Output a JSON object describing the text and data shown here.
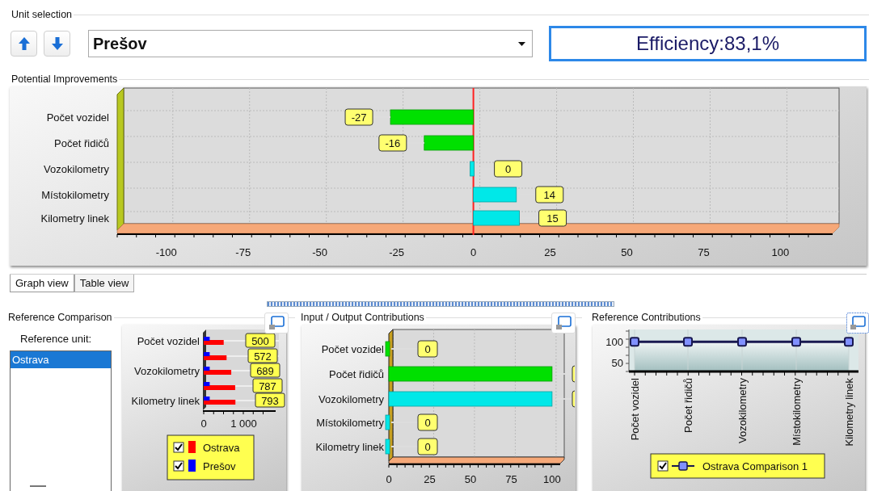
{
  "unit_selection": {
    "title": "Unit selection",
    "unit": "Prešov",
    "efficiency": "Efficiency:83,1%"
  },
  "potential_improvements": {
    "title": "Potential Improvements",
    "chart_data": {
      "type": "bar",
      "orientation": "horizontal",
      "categories": [
        "Počet vozidel",
        "Počet řidičů",
        "Vozokilometry",
        "Místokilometry",
        "Kilometry linek"
      ],
      "series": [
        {
          "color": "#00e000",
          "values": [
            -27,
            -16,
            null,
            null,
            null
          ]
        },
        {
          "color": "#00e8e8",
          "values": [
            null,
            null,
            0,
            14,
            15
          ]
        }
      ],
      "xlim": [
        -116,
        117
      ],
      "xticks": [
        -100,
        -75,
        -50,
        -25,
        0,
        25,
        50,
        75,
        100
      ],
      "grid": true,
      "data_labels": true,
      "ref_lines": [
        {
          "axis": "x",
          "value": 0,
          "color": "#ff2020"
        }
      ]
    },
    "tabs": [
      {
        "label": "Graph view",
        "selected": true
      },
      {
        "label": "Table view",
        "selected": false
      }
    ]
  },
  "reference_comparison": {
    "title": "Reference Comparison",
    "reference_unit_label": "Reference unit:",
    "units": [
      {
        "label": "Ostrava",
        "selected": true
      }
    ],
    "chart_data": {
      "type": "bar",
      "orientation": "horizontal",
      "categories": [
        "Počet vozidel",
        null,
        "Vozokilometry",
        null,
        "Kilometry linek"
      ],
      "series": [
        {
          "name": "Ostrava",
          "color": "#ff0000",
          "values": [
            500,
            572,
            689,
            787,
            793
          ]
        },
        {
          "name": "Prešov",
          "color": "#0000ff",
          "values": [
            150,
            150,
            150,
            150,
            150
          ]
        }
      ],
      "xlim": [
        0,
        1800
      ],
      "xticks": [
        0,
        {
          "value": 1000,
          "label": "1 000"
        }
      ],
      "grid": true,
      "legend": "bottom",
      "value_labels": [
        "500",
        "572",
        "689",
        "787",
        "793"
      ]
    },
    "legend": [
      {
        "checked": true
      },
      {
        "checked": true
      }
    ]
  },
  "input_output_contributions": {
    "title": "Input / Output Contributions",
    "chart_data": {
      "type": "bar",
      "orientation": "horizontal",
      "categories": [
        "Počet vozidel",
        "Počet řidičů",
        "Vozokilometry",
        "Místokilometry",
        "Kilometry linek"
      ],
      "series": [
        {
          "color": "#00e000",
          "values": [
            0,
            100,
            null,
            null,
            null
          ]
        },
        {
          "color": "#00e8e8",
          "values": [
            null,
            null,
            100,
            0,
            0
          ]
        }
      ],
      "xlim": [
        0,
        105
      ],
      "xticks": [
        0,
        25,
        50,
        75,
        100
      ],
      "grid": true,
      "value_labels": [
        "0",
        null,
        null,
        "0",
        "0"
      ]
    }
  },
  "reference_contributions": {
    "title": "Reference Contributions",
    "chart_data": {
      "type": "area",
      "categories": [
        "Počet vozidel",
        "Počet řidičů",
        "Vozokilometry",
        "Místokilometry",
        "Kilometry linek"
      ],
      "series": [
        {
          "name": "Ostrava Comparison 1",
          "color": "#8090ff",
          "marker": "square",
          "values": [
            100,
            100,
            100,
            100,
            100
          ]
        }
      ],
      "ylim": [
        30,
        130
      ],
      "yticks": [
        50,
        100
      ],
      "grid": true,
      "legend": "bottom"
    },
    "legend": [
      {
        "checked": true
      }
    ]
  }
}
